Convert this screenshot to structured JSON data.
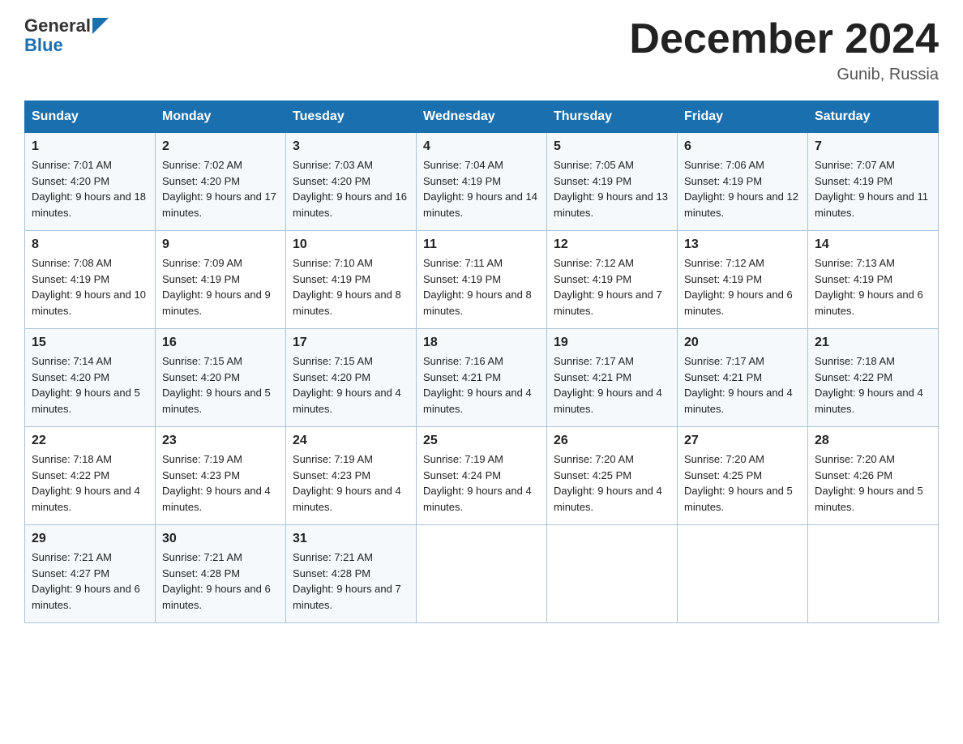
{
  "header": {
    "logo_text_general": "General",
    "logo_text_blue": "Blue",
    "month_title": "December 2024",
    "location": "Gunib, Russia"
  },
  "days_of_week": [
    "Sunday",
    "Monday",
    "Tuesday",
    "Wednesday",
    "Thursday",
    "Friday",
    "Saturday"
  ],
  "weeks": [
    [
      {
        "day": "1",
        "sunrise": "7:01 AM",
        "sunset": "4:20 PM",
        "daylight": "9 hours and 18 minutes."
      },
      {
        "day": "2",
        "sunrise": "7:02 AM",
        "sunset": "4:20 PM",
        "daylight": "9 hours and 17 minutes."
      },
      {
        "day": "3",
        "sunrise": "7:03 AM",
        "sunset": "4:20 PM",
        "daylight": "9 hours and 16 minutes."
      },
      {
        "day": "4",
        "sunrise": "7:04 AM",
        "sunset": "4:19 PM",
        "daylight": "9 hours and 14 minutes."
      },
      {
        "day": "5",
        "sunrise": "7:05 AM",
        "sunset": "4:19 PM",
        "daylight": "9 hours and 13 minutes."
      },
      {
        "day": "6",
        "sunrise": "7:06 AM",
        "sunset": "4:19 PM",
        "daylight": "9 hours and 12 minutes."
      },
      {
        "day": "7",
        "sunrise": "7:07 AM",
        "sunset": "4:19 PM",
        "daylight": "9 hours and 11 minutes."
      }
    ],
    [
      {
        "day": "8",
        "sunrise": "7:08 AM",
        "sunset": "4:19 PM",
        "daylight": "9 hours and 10 minutes."
      },
      {
        "day": "9",
        "sunrise": "7:09 AM",
        "sunset": "4:19 PM",
        "daylight": "9 hours and 9 minutes."
      },
      {
        "day": "10",
        "sunrise": "7:10 AM",
        "sunset": "4:19 PM",
        "daylight": "9 hours and 8 minutes."
      },
      {
        "day": "11",
        "sunrise": "7:11 AM",
        "sunset": "4:19 PM",
        "daylight": "9 hours and 8 minutes."
      },
      {
        "day": "12",
        "sunrise": "7:12 AM",
        "sunset": "4:19 PM",
        "daylight": "9 hours and 7 minutes."
      },
      {
        "day": "13",
        "sunrise": "7:12 AM",
        "sunset": "4:19 PM",
        "daylight": "9 hours and 6 minutes."
      },
      {
        "day": "14",
        "sunrise": "7:13 AM",
        "sunset": "4:19 PM",
        "daylight": "9 hours and 6 minutes."
      }
    ],
    [
      {
        "day": "15",
        "sunrise": "7:14 AM",
        "sunset": "4:20 PM",
        "daylight": "9 hours and 5 minutes."
      },
      {
        "day": "16",
        "sunrise": "7:15 AM",
        "sunset": "4:20 PM",
        "daylight": "9 hours and 5 minutes."
      },
      {
        "day": "17",
        "sunrise": "7:15 AM",
        "sunset": "4:20 PM",
        "daylight": "9 hours and 4 minutes."
      },
      {
        "day": "18",
        "sunrise": "7:16 AM",
        "sunset": "4:21 PM",
        "daylight": "9 hours and 4 minutes."
      },
      {
        "day": "19",
        "sunrise": "7:17 AM",
        "sunset": "4:21 PM",
        "daylight": "9 hours and 4 minutes."
      },
      {
        "day": "20",
        "sunrise": "7:17 AM",
        "sunset": "4:21 PM",
        "daylight": "9 hours and 4 minutes."
      },
      {
        "day": "21",
        "sunrise": "7:18 AM",
        "sunset": "4:22 PM",
        "daylight": "9 hours and 4 minutes."
      }
    ],
    [
      {
        "day": "22",
        "sunrise": "7:18 AM",
        "sunset": "4:22 PM",
        "daylight": "9 hours and 4 minutes."
      },
      {
        "day": "23",
        "sunrise": "7:19 AM",
        "sunset": "4:23 PM",
        "daylight": "9 hours and 4 minutes."
      },
      {
        "day": "24",
        "sunrise": "7:19 AM",
        "sunset": "4:23 PM",
        "daylight": "9 hours and 4 minutes."
      },
      {
        "day": "25",
        "sunrise": "7:19 AM",
        "sunset": "4:24 PM",
        "daylight": "9 hours and 4 minutes."
      },
      {
        "day": "26",
        "sunrise": "7:20 AM",
        "sunset": "4:25 PM",
        "daylight": "9 hours and 4 minutes."
      },
      {
        "day": "27",
        "sunrise": "7:20 AM",
        "sunset": "4:25 PM",
        "daylight": "9 hours and 5 minutes."
      },
      {
        "day": "28",
        "sunrise": "7:20 AM",
        "sunset": "4:26 PM",
        "daylight": "9 hours and 5 minutes."
      }
    ],
    [
      {
        "day": "29",
        "sunrise": "7:21 AM",
        "sunset": "4:27 PM",
        "daylight": "9 hours and 6 minutes."
      },
      {
        "day": "30",
        "sunrise": "7:21 AM",
        "sunset": "4:28 PM",
        "daylight": "9 hours and 6 minutes."
      },
      {
        "day": "31",
        "sunrise": "7:21 AM",
        "sunset": "4:28 PM",
        "daylight": "9 hours and 7 minutes."
      },
      null,
      null,
      null,
      null
    ]
  ],
  "labels": {
    "sunrise": "Sunrise:",
    "sunset": "Sunset:",
    "daylight": "Daylight:"
  }
}
